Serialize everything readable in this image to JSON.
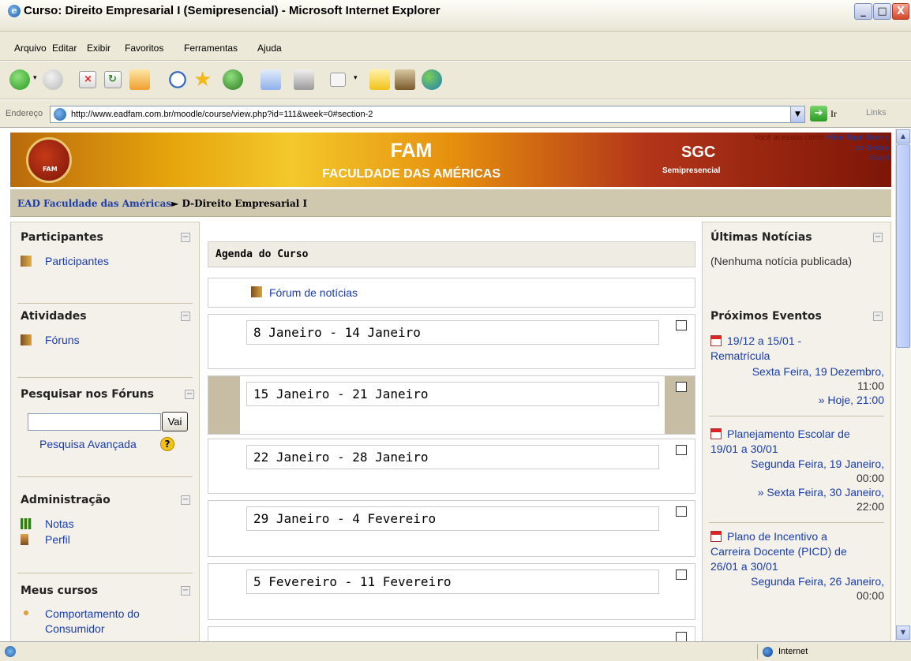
{
  "window": {
    "title": "Curso: Direito Empresarial I (Semipresencial) - Microsoft Internet Explorer",
    "minimize_label": "_",
    "maximize_label": "□",
    "close_label": "X"
  },
  "menu": {
    "items": [
      "Arquivo",
      "Editar",
      "Exibir",
      "Favoritos",
      "Ferramentas",
      "Ajuda"
    ]
  },
  "toolbar": {
    "icons": [
      "back-icon",
      "forward-icon",
      "stop-icon",
      "refresh-icon",
      "home-icon",
      "search-icon",
      "favorites-icon",
      "history-icon",
      "mail-icon",
      "print-icon",
      "edit-icon",
      "folder-icon",
      "research-icon",
      "messenger-icon"
    ]
  },
  "address": {
    "label": "Endereço",
    "url": "http://www.eadfam.com.br/moodle/course/view.php?id=111&week=0#section-2",
    "go_label": "Ir",
    "links_label": "Links"
  },
  "banner": {
    "title": "FAM",
    "subtitle": "FACULDADE DAS AMÉRICAS",
    "logo_text": "FAM",
    "sgc": "SGC",
    "sgc_sub": "Semipresencial",
    "login_prefix": "Você acessou como",
    "login_user": "Aline Topic Bueno de Godoy",
    "logout": "(Sair)"
  },
  "breadcrumb": {
    "home": "EAD Faculdade das Américas",
    "separator": "►",
    "current": "D-Direito Empresarial I"
  },
  "left": {
    "participantes": {
      "title": "Participantes",
      "link": "Participantes"
    },
    "atividades": {
      "title": "Atividades",
      "link": "Fóruns"
    },
    "pesquisar": {
      "title": "Pesquisar nos Fóruns",
      "button": "Vai",
      "advanced": "Pesquisa Avançada",
      "help": "?"
    },
    "administracao": {
      "title": "Administração",
      "links": [
        "Notas",
        "Perfil"
      ]
    },
    "meus_cursos": {
      "title": "Meus cursos",
      "link": "Comportamento do Consumidor"
    }
  },
  "center": {
    "agenda_title": "Agenda do Curso",
    "forum_link": "Fórum de notícias",
    "weeks": [
      "8 Janeiro - 14 Janeiro",
      "15 Janeiro - 21 Janeiro",
      "22 Janeiro - 28 Janeiro",
      "29 Janeiro - 4 Fevereiro",
      "5 Fevereiro - 11 Fevereiro"
    ],
    "current_week_index": 1
  },
  "right": {
    "noticias": {
      "title": "Últimas Notícias",
      "empty": "(Nenhuma notícia publicada)"
    },
    "eventos": {
      "title": "Próximos Eventos",
      "items": [
        {
          "title_line1": "19/12 a 15/01 -",
          "title_line2": "Rematrícula",
          "date_line1": "Sexta Feira, 19 Dezembro,",
          "date_line2": "11:00",
          "date_line3": "» Hoje, 21:00"
        },
        {
          "title_line1": "Planejamento Escolar de",
          "title_line2": "19/01 a 30/01",
          "date_line1": "Segunda Feira, 19 Janeiro,",
          "date_line2": "00:00",
          "date_line3": "» Sexta Feira, 30 Janeiro,",
          "date_line4": "22:00"
        },
        {
          "title_line1": "Plano de Incentivo a",
          "title_line2": "Carreira Docente (PICD) de",
          "title_line3": "26/01 a 30/01",
          "date_line1": "Segunda Feira, 26 Janeiro,",
          "date_line2": "00:00"
        }
      ]
    }
  },
  "status": {
    "zone": "Internet"
  },
  "colors": {
    "link": "#1a3da8",
    "block_bg": "#f3f1ea",
    "crumb_bg": "#cfc7ae",
    "current_week": "#c7bda4"
  }
}
